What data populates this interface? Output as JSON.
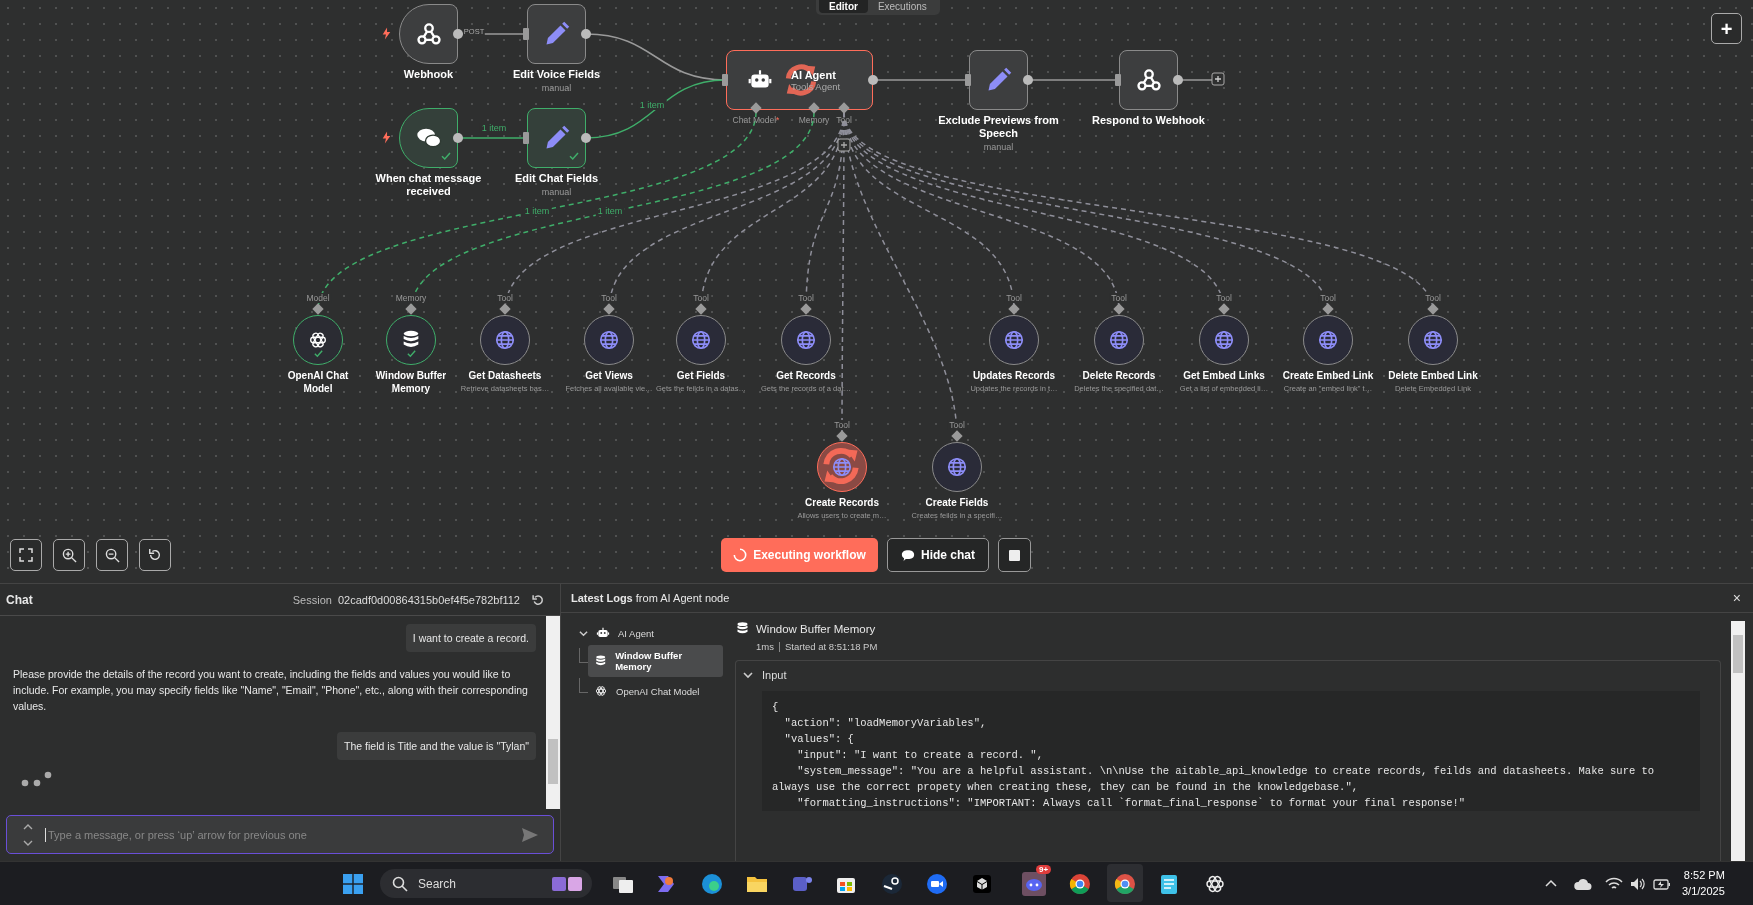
{
  "canvas": {
    "tabs": [
      {
        "label": "Editor",
        "selected": true
      },
      {
        "label": "Executions",
        "selected": false
      }
    ],
    "nodes": [
      {
        "title": "Webhook",
        "kind": "webhook",
        "trigger": true,
        "success": false,
        "running": false
      },
      {
        "title": "Edit Voice Fields",
        "subtitle": "manual",
        "kind": "edit",
        "trigger": false,
        "success": false,
        "running": false
      },
      {
        "title": "When chat message received",
        "kind": "chat",
        "trigger": true,
        "success": true,
        "running": false
      },
      {
        "title": "Edit Chat Fields",
        "subtitle": "manual",
        "kind": "edit",
        "trigger": false,
        "success": true,
        "running": false
      },
      {
        "title": "AI Agent",
        "subtitle": "Tools Agent",
        "kind": "agent",
        "trigger": false,
        "success": false,
        "running": true,
        "ports": [
          {
            "label": "Chat Model",
            "mark": "*"
          },
          {
            "label": "Memory"
          },
          {
            "label": "Tool"
          }
        ]
      },
      {
        "title": "Exclude Previews from Speech",
        "subtitle": "manual",
        "kind": "edit",
        "trigger": false,
        "success": false,
        "running": false
      },
      {
        "title": "Respond to Webhook",
        "kind": "webhook",
        "trigger": false,
        "success": false,
        "running": false
      }
    ],
    "add_node": "+",
    "edges": [
      {
        "label": "POST",
        "active": false
      },
      {
        "label": "1 item",
        "active": true
      },
      {
        "label": "1 item",
        "active": true
      },
      {
        "label": "1 item",
        "active": true
      },
      {
        "label": "1 item",
        "active": true
      }
    ],
    "sub_nodes": [
      {
        "port": "Model",
        "title": "OpenAI Chat Model",
        "kind": "openai",
        "success": true,
        "running": false
      },
      {
        "port": "Memory",
        "title": "Window Buffer Memory",
        "kind": "database",
        "success": true,
        "running": false
      },
      {
        "port": "Tool",
        "title": "Get Datasheets",
        "subtitle": "Retrieve datasheets bas…",
        "kind": "globe",
        "success": false,
        "running": false
      },
      {
        "port": "Tool",
        "title": "Get Views",
        "subtitle": "Fetches all available vie…",
        "kind": "globe",
        "success": false,
        "running": false
      },
      {
        "port": "Tool",
        "title": "Get Fields",
        "subtitle": "Gets the feilds in a datas…",
        "kind": "globe",
        "success": false,
        "running": false
      },
      {
        "port": "Tool",
        "title": "Get Records",
        "subtitle": "Gets the records of a dat…",
        "kind": "globe",
        "success": false,
        "running": false
      },
      {
        "port": "Tool",
        "title": "Updates Records",
        "subtitle": "Updates the records in t…",
        "kind": "globe",
        "success": false,
        "running": false
      },
      {
        "port": "Tool",
        "title": "Delete Records",
        "subtitle": "Deletes the specified dat…",
        "kind": "globe",
        "success": false,
        "running": false
      },
      {
        "port": "Tool",
        "title": "Get Embed Links",
        "subtitle": "Get a list of embedded li…",
        "kind": "globe",
        "success": false,
        "running": false
      },
      {
        "port": "Tool",
        "title": "Create Embed Link",
        "subtitle": "Create an \"embed link\" t…",
        "kind": "globe",
        "success": false,
        "running": false
      },
      {
        "port": "Tool",
        "title": "Delete Embed Link",
        "subtitle": "Delete Embedded Link",
        "kind": "globe",
        "success": false,
        "running": false
      },
      {
        "port": "Tool",
        "title": "Create Records",
        "subtitle": "Allows users to create m…",
        "kind": "globe",
        "success": false,
        "running": true
      },
      {
        "port": "Tool",
        "title": "Create Fields",
        "subtitle": "Creates feilds in a specifi…",
        "kind": "globe",
        "success": false,
        "running": false
      }
    ],
    "execute_button": "Executing workflow",
    "chat_button": "Hide chat"
  },
  "chat": {
    "title": "Chat",
    "session_label": "Session",
    "session_id": "02cadf0d00864315b0ef4f5e782bf112",
    "messages": [
      {
        "kind": "user",
        "text": "I want to create a record."
      },
      {
        "kind": "bot",
        "text": "Please provide the details of the record you want to create, including the fields and values you would like to include. For example, you may specify fields like \"Name\", \"Email\", \"Phone\", etc., along with their corresponding values."
      },
      {
        "kind": "user",
        "text": "The field is Title and the value is \"Tylan\""
      }
    ],
    "typing": true,
    "placeholder": "Type a message, or press ‘up’ arrow for previous one"
  },
  "logs": {
    "title": "**Latest Logs** from AI Agent node",
    "close": "×",
    "tree": [
      {
        "label": "AI Agent",
        "kind": "agent",
        "expanded": true,
        "selected": false,
        "children": [
          {
            "label": "Window Buffer Memory",
            "kind": "database",
            "selected": true
          },
          {
            "label": "OpenAI Chat Model",
            "kind": "openai",
            "selected": false
          }
        ]
      }
    ],
    "detail": {
      "title": "Window Buffer Memory",
      "kind": "database",
      "duration": "1ms",
      "started": "Started at 8:51:18 PM",
      "section": {
        "label": "Input",
        "expanded": true,
        "code": [
          "{",
          "  \"action\": \"loadMemoryVariables\",",
          "  \"values\": {",
          "    \"input\": \"I want to create a record. \",",
          "    \"system_message\": \"You are a helpful assistant. \\n\\nUse the aitable_api_knowledge to create records, feilds and datasheets. Make sure to always use the correct propety when creating these, they can be found in the knowledgebase.\",",
          "    \"formatting_instructions\": \"IMPORTANT: Always call `format_final_response` to format your final response!\""
        ]
      }
    }
  },
  "taskbar": {
    "search": "Search",
    "badge": "9+",
    "time": "8:52 PM",
    "date": "3/1/2025"
  }
}
